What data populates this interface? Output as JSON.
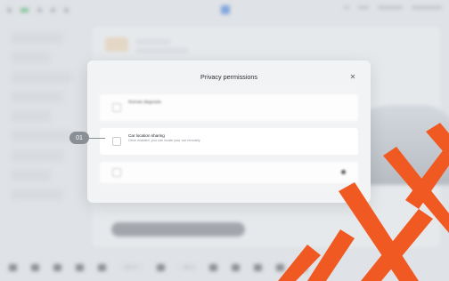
{
  "dialog": {
    "title": "Privacy permissions",
    "close_icon": "close-icon",
    "rows": [
      {
        "title": "Remote diagnosis",
        "subtitle": "",
        "checked": false
      },
      {
        "title": "Car location sharing",
        "subtitle": "Once enabled, you can locate your car remotely",
        "checked": false
      },
      {
        "title": "",
        "subtitle": "",
        "checked": false
      }
    ]
  },
  "callout": {
    "label": "01"
  },
  "bottombar": {
    "temp_left": "‹ 26.5° ›",
    "temp_right": "‹ 26.5"
  },
  "colors": {
    "watermark": "#f05a22",
    "callout": "#8a8f96"
  }
}
